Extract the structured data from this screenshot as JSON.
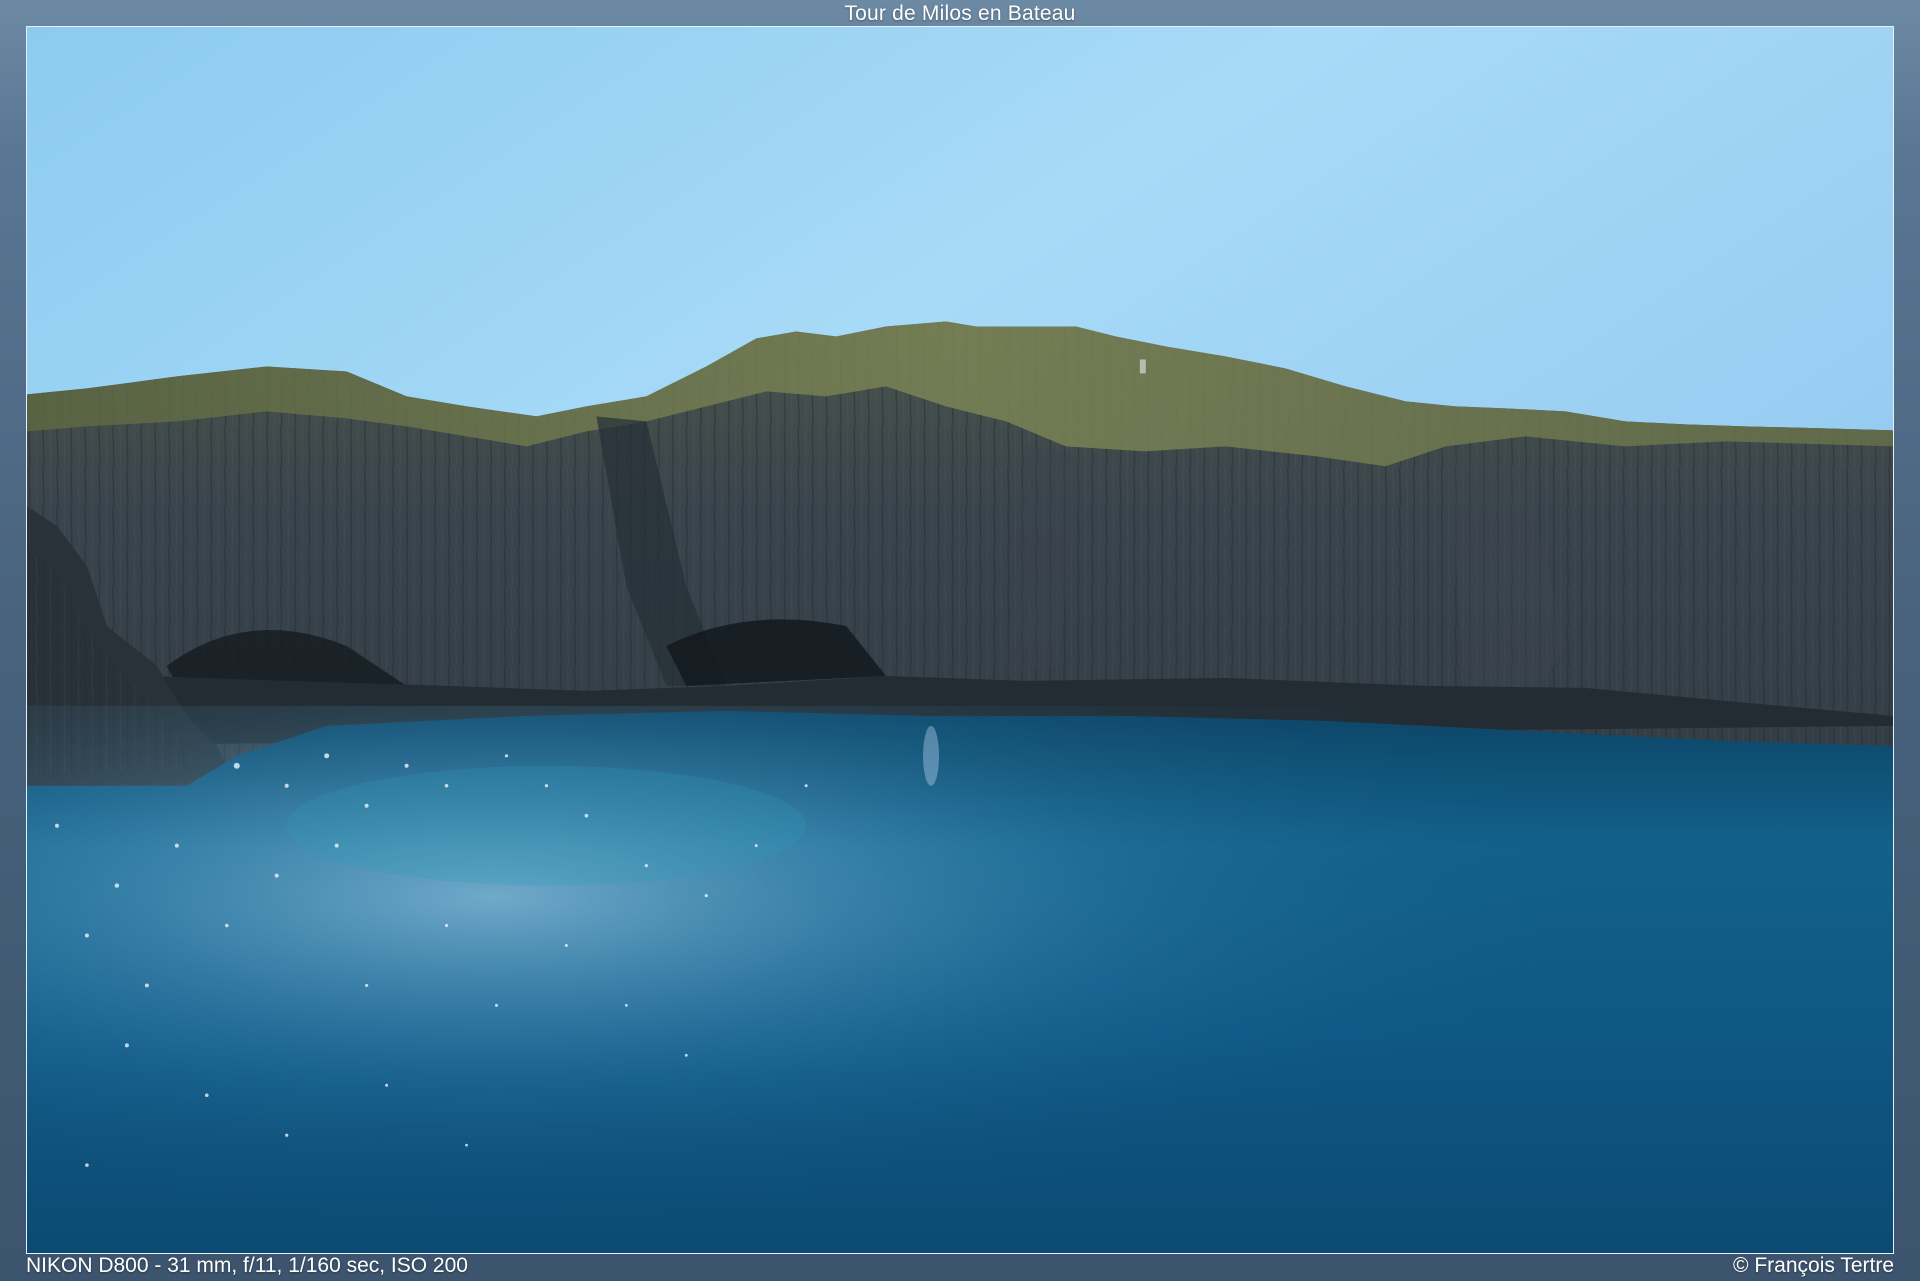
{
  "viewer": {
    "title": "Tour de Milos en Bateau",
    "exif": "NIKON D800 - 31 mm, f/11, 1/160 sec, ISO 200",
    "copyright": "© François Tertre"
  },
  "photo": {
    "subject": "basalt-cliffs-and-sea",
    "colors": {
      "sky_top": "#7bbbe9",
      "sky_horizon": "#b4def6",
      "cliff_dark": "#2f3a43",
      "cliff_mid": "#46515a",
      "vegetation": "#6d7a45",
      "sea_deep": "#0f4f78",
      "sea_light": "#1b7aa0"
    }
  }
}
